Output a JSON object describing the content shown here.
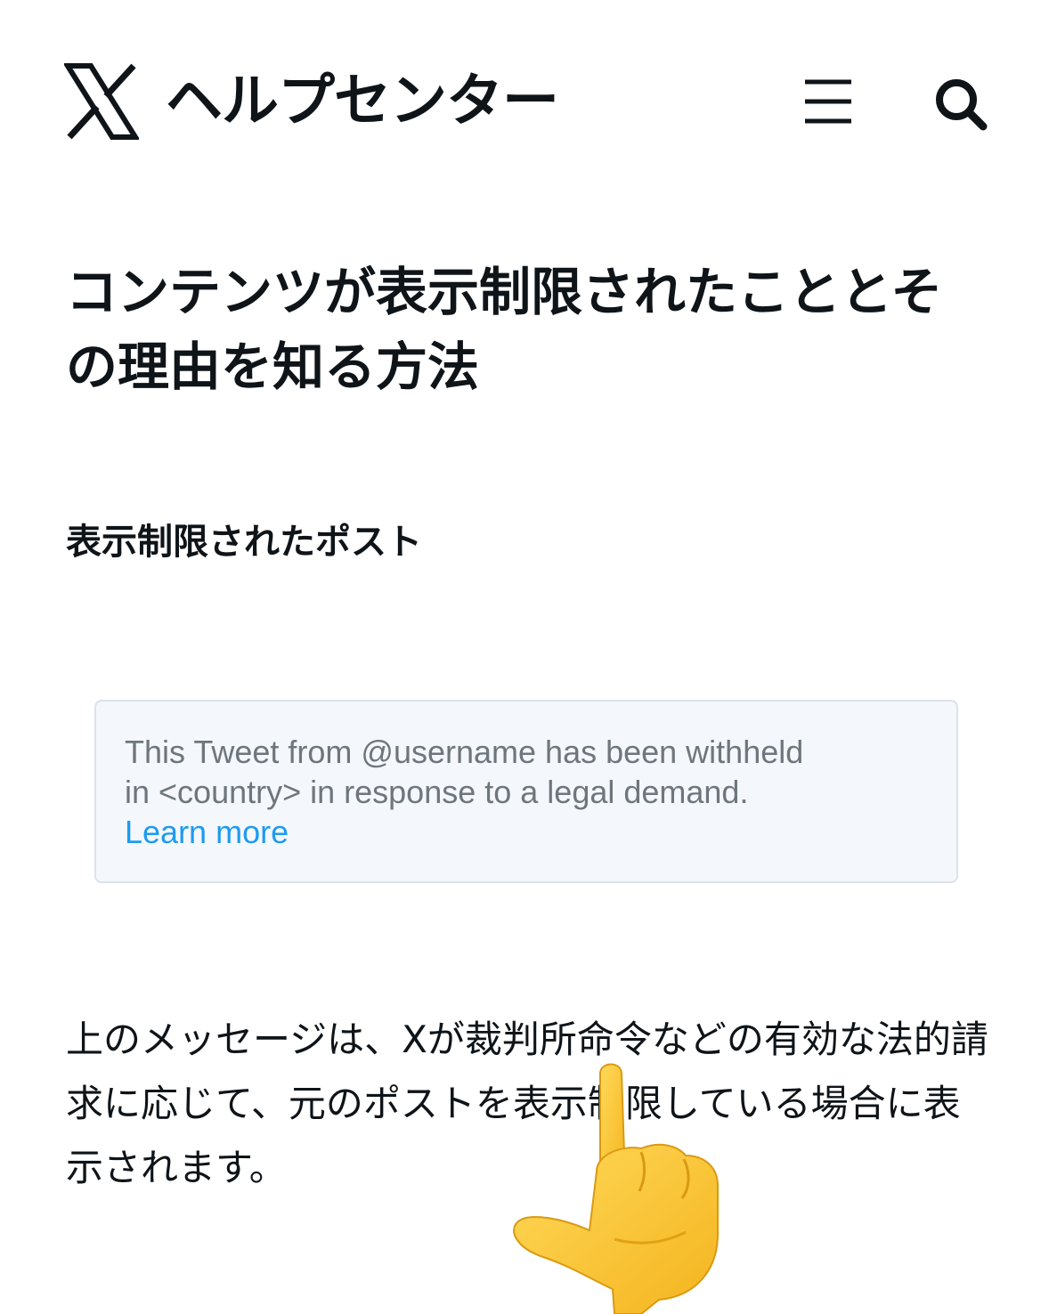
{
  "header": {
    "brand_title": "ヘルプセンター",
    "logo_icon": "x-logo-icon",
    "menu_icon": "hamburger-menu-icon",
    "search_icon": "search-icon"
  },
  "article": {
    "title": "コンテンツが表示制限されたこととその理由を知る方法",
    "section_heading": "表示制限されたポスト",
    "notice": {
      "line1": "This Tweet from @username has been withheld",
      "line2": "in <country> in response to a legal demand.",
      "link": "Learn more"
    },
    "body": "上のメッセージは、Xが裁判所命令などの有効な法的請求に応じて、元のポストを表示制限している場合に表示されます。"
  },
  "overlay": {
    "emoji_icon": "pointing-up-hand-icon"
  },
  "colors": {
    "text": "#0f1419",
    "muted": "#6e767d",
    "link": "#1d9bf0",
    "card_bg": "#f4f7fb",
    "card_border": "#dde2e8",
    "hand_skin": "#fbc93d"
  }
}
